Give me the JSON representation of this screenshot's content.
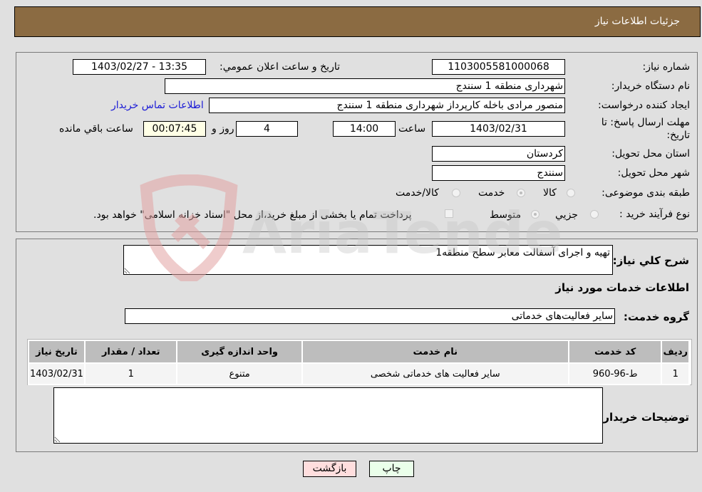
{
  "header": {
    "title": "جزئيات اطلاعات نياز"
  },
  "details": {
    "need_number": {
      "label": "شماره نياز:",
      "value": "1103005581000068"
    },
    "announce_datetime": {
      "label": "تاريخ و ساعت اعلان عمومي:",
      "value": "1403/02/27 - 13:35"
    },
    "buyer_org": {
      "label": "نام دستگاه خريدار:",
      "value": "شهرداری منطقه 1 سنندج"
    },
    "requester": {
      "label": "ايجاد کننده درخواست:",
      "value": "منصور مرادی باخله کارپرداز شهرداری منطقه 1 سنندج"
    },
    "buyer_contact_link": "اطلاعات تماس خريدار",
    "deadline": {
      "label_line1": "مهلت ارسال پاسخ: تا",
      "label_line2": "تاريخ:",
      "date": "1403/02/31",
      "time_label": "ساعت",
      "time": "14:00",
      "days": "4",
      "days_label": "روز و",
      "remaining": "00:07:45",
      "remaining_label": "ساعت باقي مانده"
    },
    "province": {
      "label": "استان محل تحويل:",
      "value": "کردستان"
    },
    "city": {
      "label": "شهر محل تحويل:",
      "value": "سنندج"
    },
    "category": {
      "label": "طبقه بندی موضوعی:",
      "options": [
        {
          "label": "کالا",
          "checked": false
        },
        {
          "label": "خدمت",
          "checked": true
        },
        {
          "label": "کالا/خدمت",
          "checked": false
        }
      ]
    },
    "purchase_process": {
      "label": "نوع فرآيند خريد :",
      "options": [
        {
          "label": "جزيي",
          "checked": false
        },
        {
          "label": "متوسط",
          "checked": true
        }
      ],
      "treasury_checkbox": {
        "checked": false,
        "label": "پرداخت تمام يا بخشی از مبلغ خريد،از محل \"اسناد خزانه اسلامی\" خواهد بود."
      }
    }
  },
  "summary": {
    "description_label": "شرح کلي نياز:",
    "description_value": "تهيه و اجرای آسفالت معابر سطح منطقه1",
    "services_heading": "اطلاعات خدمات مورد نياز",
    "service_group_label": "گروه خدمت:",
    "service_group_value": "ساير فعاليت‌های خدماتی"
  },
  "services_table": {
    "columns": [
      "رديف",
      "کد خدمت",
      "نام خدمت",
      "واحد اندازه گيری",
      "تعداد / مقدار",
      "تاريخ نياز"
    ],
    "rows": [
      [
        "1",
        "ط-96-960",
        "ساير فعاليت های خدماتی شخصی",
        "متنوع",
        "1",
        "1403/02/31"
      ]
    ]
  },
  "buyer_notes": {
    "label": "توضيحات خريدار:",
    "value": ""
  },
  "buttons": {
    "print": "چاپ",
    "back": "بازگشت"
  },
  "colors": {
    "header_bg": "#8b6b42",
    "print_bg": "#eaffea",
    "back_bg": "#ffdede",
    "link": "#1a1ad6"
  },
  "watermark": {
    "text": "AriaTender.net"
  }
}
